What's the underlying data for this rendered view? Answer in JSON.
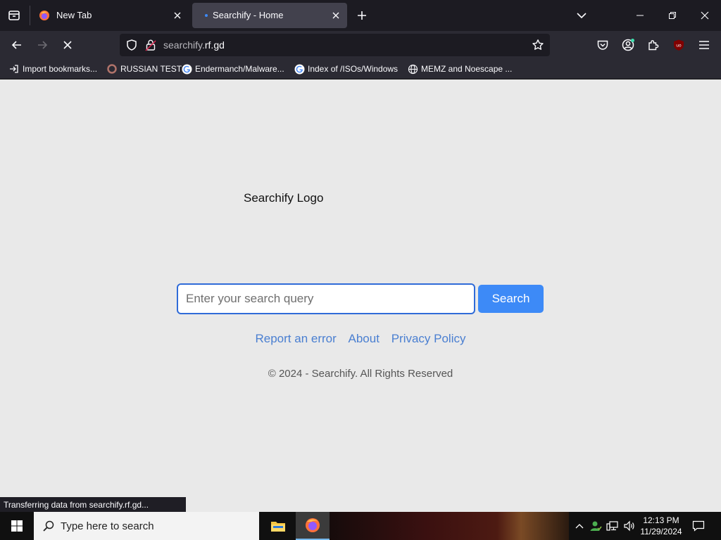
{
  "browser": {
    "tabs": [
      {
        "title": "New Tab",
        "active": false
      },
      {
        "title": "Searchify - Home",
        "active": true
      }
    ],
    "url": {
      "prefix": "searchify.",
      "host": "rf.gd"
    },
    "bookmarks": [
      {
        "label": "Import bookmarks...",
        "icon": "import-icon"
      },
      {
        "label": "RUSSIAN TEST",
        "icon": "site-favicon"
      },
      {
        "label": "Endermanch/Malware...",
        "icon": "google-icon"
      },
      {
        "label": "Index of /ISOs/Windows",
        "icon": "google-icon"
      },
      {
        "label": "MEMZ and Noescape ...",
        "icon": "globe-icon"
      }
    ],
    "status_text": "Transferring data from searchify.rf.gd..."
  },
  "page": {
    "logo_alt": "Searchify Logo",
    "search": {
      "placeholder": "Enter your search query",
      "value": "",
      "button_label": "Search"
    },
    "links": [
      "Report an error",
      "About",
      "Privacy Policy"
    ],
    "copyright": "© 2024 - Searchify. All Rights Reserved"
  },
  "taskbar": {
    "search_placeholder": "Type here to search",
    "time": "12:13 PM",
    "date": "11/29/2024"
  },
  "colors": {
    "accent": "#3d8af7",
    "link": "#4a7fd1",
    "page_bg": "#e9e9e9",
    "browser_chrome": "#2b2a33"
  }
}
